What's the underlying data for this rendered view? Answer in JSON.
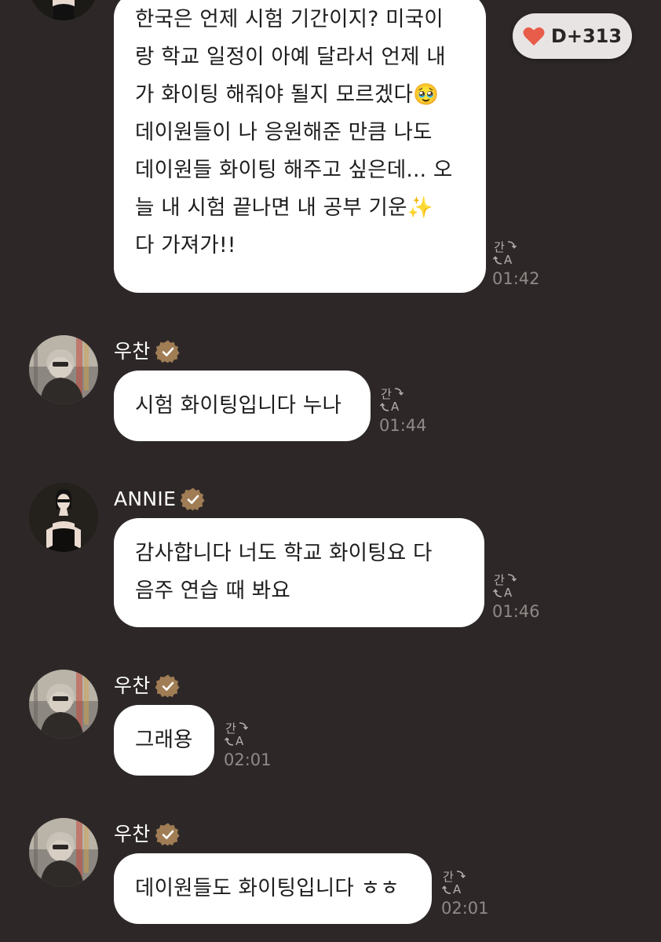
{
  "dday_badge": {
    "label": "D+313",
    "icon": "heart-icon",
    "heart_color": "#e85c4a"
  },
  "colors": {
    "background": "#2d2827",
    "bubble": "#ffffff",
    "time": "#8f8a88",
    "verified": "#a07d55"
  },
  "translate_icon_label": "간A",
  "messages": [
    {
      "sender": "",
      "lines": [
        "한국은 언제 시험 기간이지? 미국이",
        "랑 학교 일정이 아예 달라서 언제 내",
        "가 화이팅 해줘야 될지 모르겠다🥹",
        "데이원들이 나 응원해준 만큼 나도",
        "데이원들 화이팅 해주고 싶은데... 오",
        "늘 내 시험 끝나면 내 공부 기운✨",
        "다 가져가!!"
      ],
      "time": "01:42"
    },
    {
      "sender": "우찬",
      "lines": [
        "시험 화이팅입니다 누나"
      ],
      "time": "01:44"
    },
    {
      "sender": "ANNIE",
      "lines": [
        "감사합니다 너도 학교 화이팅요 다",
        "음주 연습 때 봐요"
      ],
      "time": "01:46"
    },
    {
      "sender": "우찬",
      "lines": [
        "그래용"
      ],
      "time": "02:01"
    },
    {
      "sender": "우찬",
      "lines": [
        "데이원들도 화이팅입니다 ㅎㅎ"
      ],
      "time": "02:01"
    }
  ]
}
